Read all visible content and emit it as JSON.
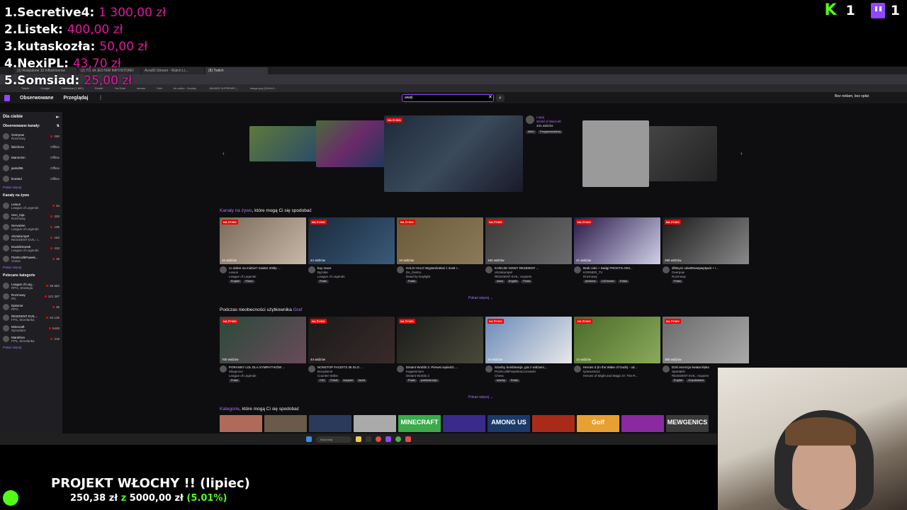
{
  "donations": [
    {
      "rank": "1.",
      "name": "Secretive4:",
      "amount": "1 300,00 zł"
    },
    {
      "rank": "2.",
      "name": "Listek:",
      "amount": "400,00 zł"
    },
    {
      "rank": "3.",
      "name": "kutaskozła:",
      "amount": "50,00 zł"
    },
    {
      "rank": "4.",
      "name": "NexiPL:",
      "amount": "43,70 zł"
    },
    {
      "rank": "5.",
      "name": "Somsiad:",
      "amount": "25,00 zł"
    }
  ],
  "counters": {
    "kick": "1",
    "twitch": "1"
  },
  "browser": {
    "tabs": [
      "(2) Rozpalone 10 Influencerów",
      "(2) TO JA JESTEM IMPOSTORE!",
      "Avra82 Stream - Watch Li...",
      "(8) Twitch"
    ],
    "bookmarks": [
      "Twitch",
      "Google",
      "Odebrane (1 889)",
      "Reddit",
      "YouTube",
      "stream",
      "Kick",
      "Ito rodko - Szukaj...",
      "ANUBIS SUPREME (...",
      "image.png (3944×3..."
    ]
  },
  "twitch_nav": {
    "following": "Obserwowane",
    "browse": "Przeglądaj",
    "search_value": "awai|",
    "adfree": "Bez reklam, bez opłat"
  },
  "sidebar": {
    "for_you": "Dla ciebie",
    "followed_title": "Obserwowane kanały:",
    "followed": [
      {
        "name": "Overpow",
        "sub": "Rozmowy",
        "right": "290",
        "live": true
      },
      {
        "name": "listichera",
        "sub": "",
        "right": "Offline",
        "live": false
      },
      {
        "name": "MammOn",
        "sub": "",
        "right": "Offline",
        "live": false
      },
      {
        "name": "jaskol95",
        "sub": "",
        "right": "Offline",
        "live": false
      },
      {
        "name": "kmnted",
        "sub": "",
        "right": "Offline",
        "live": false
      }
    ],
    "show_more": "Pokaż więcej",
    "live_title": "Kanały na żywo",
    "live": [
      {
        "name": "Lewus",
        "sub": "League of Legends",
        "right": "34"
      },
      {
        "name": "revo_toja",
        "sub": "Rozmowy",
        "right": "203"
      },
      {
        "name": "Nervarien",
        "sub": "League of Legends",
        "right": "105"
      },
      {
        "name": "olszakumpel",
        "sub": "RESIDENT EVIL: r...",
        "right": "162"
      },
      {
        "name": "DavidSSonek",
        "sub": "League of Legends",
        "right": "233"
      },
      {
        "name": "PiotrKozlkPawek...",
        "sub": "Chess",
        "right": "19"
      }
    ],
    "cats_title": "Polecane kategorie",
    "cats": [
      {
        "name": "League of Leg...",
        "sub": "RPG, Strategia",
        "right": "66 684"
      },
      {
        "name": "Rozmowy",
        "sub": "IRL",
        "right": "121 397"
      },
      {
        "name": "Epitome",
        "sub": "RPG",
        "right": "35"
      },
      {
        "name": "RESIDENT EVIL...",
        "sub": "FPS, Strzelanka",
        "right": "64 135"
      },
      {
        "name": "Minecraft",
        "sub": "Symulator",
        "right": "6445"
      },
      {
        "name": "Marathon",
        "sub": "FPS, Strzelanka",
        "right": "218"
      }
    ]
  },
  "featured": {
    "live": "NA ŻYWO",
    "name": "Lopej",
    "game": "World of Warcraft",
    "viewers": "431 widzów",
    "tags": [
      "MMO",
      "Przyjaznewidzów"
    ]
  },
  "section1": {
    "title_pre": "Kanały na żywo",
    "title_post": ", które mogą Ci się spodobać",
    "show_more": "Pokaż więcej",
    "cards": [
      {
        "viewers": "34 widzów",
        "title": "co dobre na midzie? master 200lp ...",
        "channel": "Lewus",
        "game": "League of Legends",
        "tags": [
          "English",
          "Polski"
        ]
      },
      {
        "viewers": "44 widzów",
        "title": "buy mace",
        "channel": "Byzoke",
        "game": "League of Legends",
        "tags": [
          "Polski"
        ]
      },
      {
        "viewers": "10 widzów",
        "title": "HALO HALO Wypierdzielać z 2vs8 !...",
        "channel": "De_Destru",
        "game": "Dead by Daylight",
        "tags": [
          "Polski"
        ]
      },
      {
        "viewers": "162 widzów",
        "title": "KAŃCZE NOWY RESIDENT ...",
        "channel": "olszakumpel",
        "game": "RESIDENT EVIL: requiem",
        "tags": [
          "olsza",
          "English",
          "Polski"
        ]
      },
      {
        "viewers": "41 widzów",
        "title": "Brak cioki + Sadgi FROSTIA ONI...",
        "channel": "KORNER_TV",
        "game": "Rozmowy",
        "tags": [
          "pňvtuber",
          "L2DVtuber",
          "Polski"
        ]
      },
      {
        "viewers": "290 widzów",
        "title": "dihleyici odw90txwtpwptpwit + !...",
        "channel": "Overpow",
        "game": "Rozmowy",
        "tags": [
          "Polski"
        ]
      }
    ]
  },
  "section2": {
    "title_pre": "Podczas nieobecności użytkownika ",
    "title_user": "Graf",
    "show_more": "Pokaż więcej",
    "cards": [
      {
        "viewers": "700 widzów",
        "title": "PORANNY LOL DLA SYMPATYKÓW ...",
        "channel": "Slayproxx",
        "game": "League of Legends",
        "tags": [
          "Polski"
        ]
      },
      {
        "viewers": "44 widzów",
        "title": "NONSTOP FACEITS 3K ELO ...",
        "channel": "Bozydar44",
        "game": "Counter-Strike",
        "tags": [
          "CS2",
          "Polski",
          "bozydar",
          "faceit"
        ]
      },
      {
        "viewers": "",
        "title": "Distant Worlds 2. Pierwsi sąsiedzi, ...",
        "channel": "Kagaminium",
        "game": "Distant Worlds 2",
        "tags": [
          "Polski",
          "poklkrstromyi"
        ]
      },
      {
        "viewers": "10 widzów",
        "title": "Szachy, kombinacje, gra z widzami,...",
        "channel": "PiotrKozlkPawelKaczorowski",
        "game": "Chess",
        "tags": [
          "szachy",
          "Polski"
        ]
      },
      {
        "viewers": "14 widzów",
        "title": "Heroes 3 (In the Wake of Gods) - od...",
        "channel": "tyranusss11",
        "game": "Heroes of Might and Magic III: The R...",
        "tags": []
      },
      {
        "viewers": "380 widzów",
        "title": "Dziś recenzja świata klęka",
        "channel": "Spartakki",
        "game": "RESIDENT EVIL: requiem",
        "tags": [
          "English",
          "Drzpdbalded"
        ]
      }
    ]
  },
  "section3": {
    "title_pre": "Kategorie",
    "title_post": ", które mogą Ci się spodobać",
    "cats": [
      "",
      "",
      "",
      "",
      "MINECRAFT",
      "",
      "AMONG US",
      "",
      "Golf",
      "",
      "MEWGENICS"
    ]
  },
  "taskbar": {
    "search": "Wyszukaj"
  },
  "goal": {
    "title": "PROJEKT WŁOCHY !! (lipiec)",
    "current": "250,38 zł",
    "sep": "z",
    "target": "5000,00 zł",
    "pct": "(5.01%)",
    "progress": 0.0501
  }
}
